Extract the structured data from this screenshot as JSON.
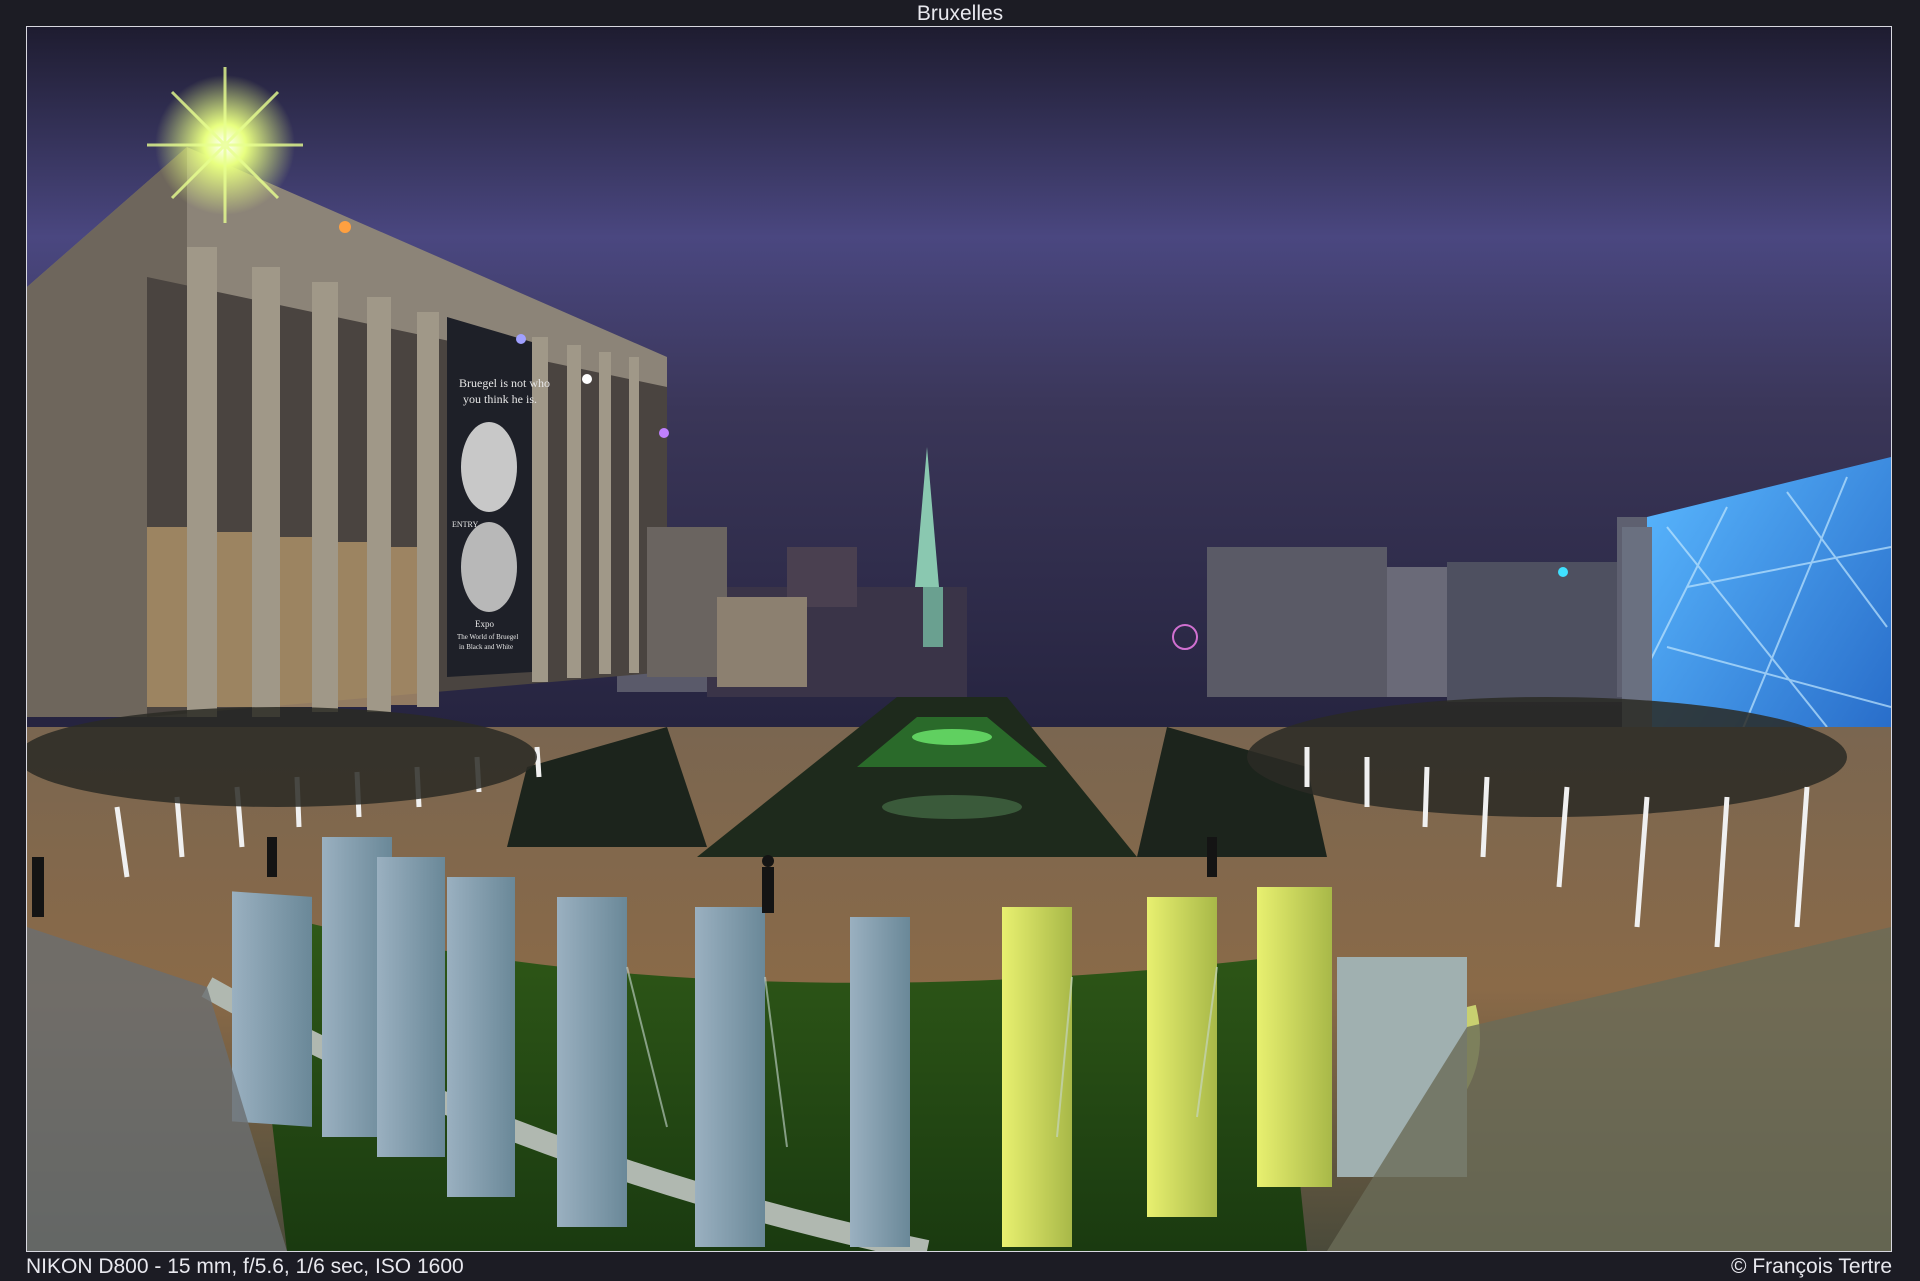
{
  "title": "Bruxelles",
  "photo": {
    "description_icon": "night-city-photo",
    "poster_lines": [
      "Bruegel is not who",
      "you think he is."
    ],
    "poster_small": [
      "Expo",
      "The World of Bruegel",
      "in Black and White"
    ],
    "poster_entry": "ENTRY"
  },
  "exif": "NIKON D800 - 15 mm, f/5.6, 1/6 sec, ISO 1600",
  "copyright": "© François Tertre",
  "colors": {
    "background": "#1c1c24",
    "sky": "#3a3658",
    "lamp_green": "#c8ff60",
    "glass_blue": "#4aa8ff",
    "pillar_yellow": "#d8e860"
  }
}
